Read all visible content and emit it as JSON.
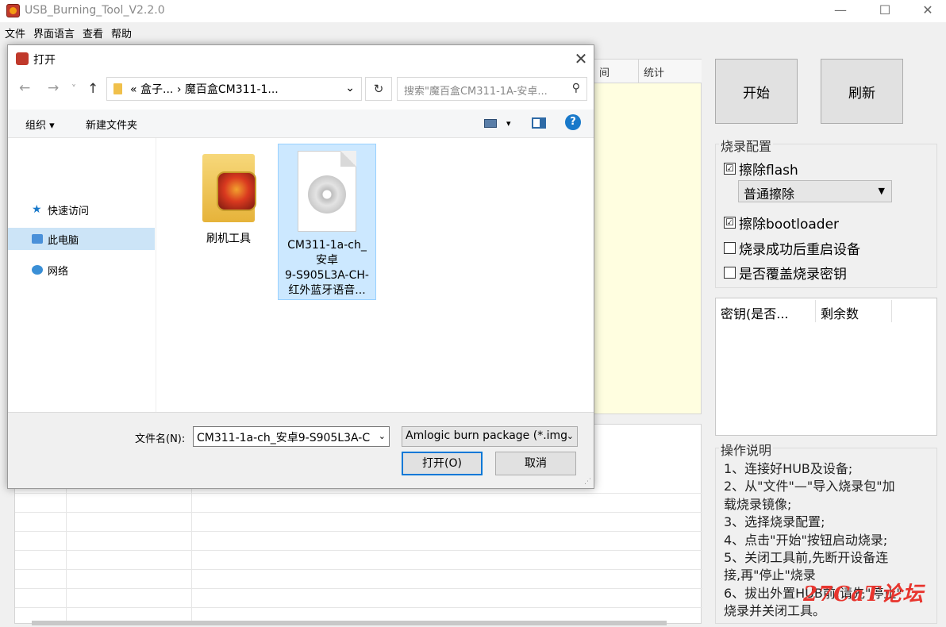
{
  "app": {
    "title": "USB_Burning_Tool_V2.2.0",
    "menu": [
      "文件",
      "界面语言",
      "查看",
      "帮助"
    ],
    "win_min": "—",
    "win_max": "☐",
    "win_close": "✕",
    "table_headers": [
      "间",
      "统计"
    ],
    "start_label": "开始",
    "refresh_label": "刷新",
    "config_title": "烧录配置",
    "erase_flash_label": "擦除flash",
    "erase_flash_checked": "☑",
    "erase_mode_value": "普通擦除",
    "erase_bootloader_label": "擦除bootloader",
    "erase_bootloader_checked": "☑",
    "reboot_label": "烧录成功后重启设备",
    "overwrite_key_label": "是否覆盖烧录密钥",
    "key_headers": [
      "密钥(是否...",
      "剩余数"
    ],
    "instructions_title": "操作说明",
    "instructions": [
      "1、连接好HUB及设备;",
      "2、从\"文件\"—\"导入烧录包\"加",
      "载烧录镜像;",
      "3、选择烧录配置;",
      "4、点击\"开始\"按钮启动烧录;",
      "5、关闭工具前,先断开设备连",
      "接,再\"停止\"烧录",
      "6、拔出外置HUB前,请先\"停止\"",
      "烧录并关闭工具。"
    ],
    "watermark": "27CaT论坛"
  },
  "dialog": {
    "title": "打开",
    "close": "✕",
    "back": "←",
    "forward": "→",
    "recent": "˅",
    "up": "↑",
    "address": "« 盒子... › 魔百盒CM311-1...",
    "address_chev": "⌄",
    "refresh": "↻",
    "search_placeholder": "搜索\"魔百盒CM311-1A-安卓...",
    "search_icon": "⚲",
    "organize": "组织 ▾",
    "new_folder": "新建文件夹",
    "view_chev": "▾",
    "help": "?",
    "nav": [
      "快速访问",
      "此电脑",
      "网络"
    ],
    "files": [
      {
        "name": "刷机工具",
        "type": "folder"
      },
      {
        "name_lines": [
          "CM311-1a-ch_",
          "安卓",
          "9-S905L3A-CH-",
          "红外蓝牙语音..."
        ],
        "type": "image-file"
      }
    ],
    "filename_label": "文件名(N):",
    "filename_value": "CM311-1a-ch_安卓9-S905L3A-C",
    "filetype_value": "Amlogic burn package (*.img",
    "open_button": "打开(O)",
    "cancel_button": "取消"
  },
  "colors": {
    "main_panel_bg": "#fffee0",
    "selection": "#cce8ff",
    "help_blue": "#1979ca",
    "watermark_red": "#e8352e"
  }
}
